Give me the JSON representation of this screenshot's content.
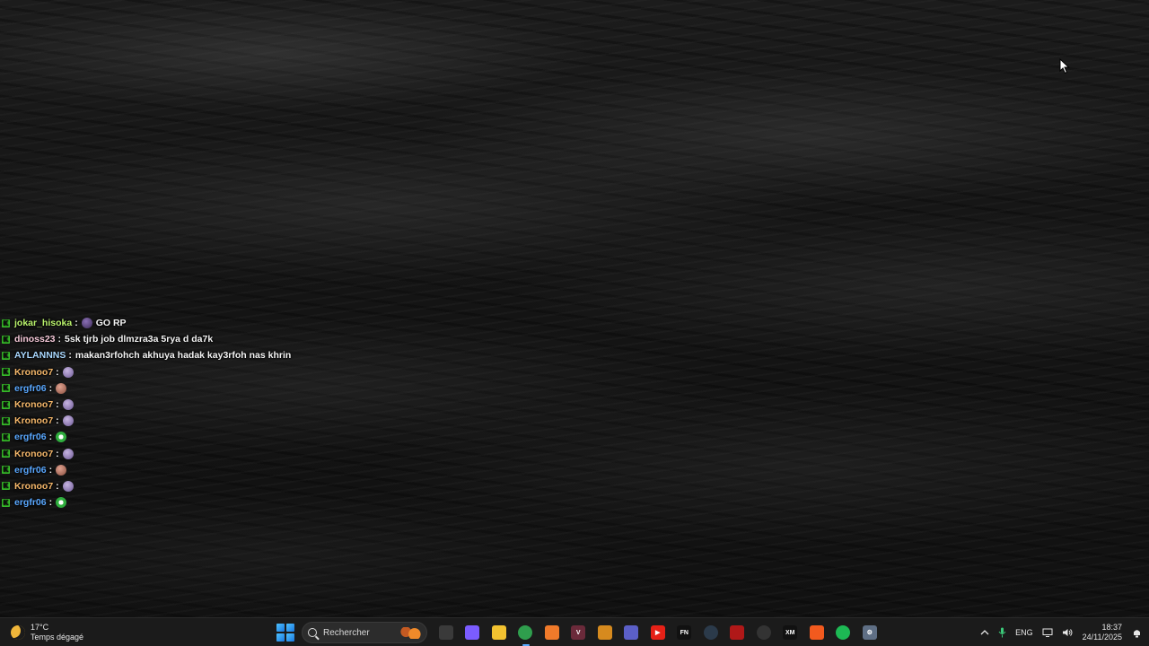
{
  "chat": [
    {
      "user": "jokar_hisoka",
      "color": "#b9f26c",
      "emote": "dark",
      "text": "GO RP"
    },
    {
      "user": "dinoss23",
      "color": "#f4c8d8",
      "emote": "",
      "text": "5sk tjrb job dlmzra3a 5rya d da7k"
    },
    {
      "user": "AYLANNNS",
      "color": "#a9d8ff",
      "emote": "",
      "text": "makan3rfohch akhuya hadak kay3rfoh nas khrin"
    },
    {
      "user": "Kronoo7",
      "color": "#f6b86b",
      "emote": "purple",
      "text": ""
    },
    {
      "user": "ergfr06",
      "color": "#5aa8ff",
      "emote": "face",
      "text": ""
    },
    {
      "user": "Kronoo7",
      "color": "#f6b86b",
      "emote": "purple",
      "text": ""
    },
    {
      "user": "Kronoo7",
      "color": "#f6b86b",
      "emote": "purple",
      "text": ""
    },
    {
      "user": "ergfr06",
      "color": "#5aa8ff",
      "emote": "green",
      "text": ""
    },
    {
      "user": "Kronoo7",
      "color": "#f6b86b",
      "emote": "purple",
      "text": ""
    },
    {
      "user": "ergfr06",
      "color": "#5aa8ff",
      "emote": "face",
      "text": ""
    },
    {
      "user": "Kronoo7",
      "color": "#f6b86b",
      "emote": "purple",
      "text": ""
    },
    {
      "user": "ergfr06",
      "color": "#5aa8ff",
      "emote": "green",
      "text": ""
    }
  ],
  "taskbar": {
    "weather": {
      "temp": "17°C",
      "desc": "Temps dégagé"
    },
    "search_label": "Rechercher",
    "apps": [
      {
        "name": "task-view-icon",
        "color": "#3a3a3a",
        "text": ""
      },
      {
        "name": "copilot-icon",
        "color": "#7b5cff",
        "text": ""
      },
      {
        "name": "file-explorer-icon",
        "color": "#f2c230",
        "text": ""
      },
      {
        "name": "chrome-icon",
        "color": "#2f9e4d",
        "text": "",
        "active": true
      },
      {
        "name": "app-orange-icon",
        "color": "#f07a2a",
        "text": ""
      },
      {
        "name": "app-maroon-icon",
        "color": "#6b2a3a",
        "text": "V"
      },
      {
        "name": "shield-app-icon",
        "color": "#d68a1e",
        "text": ""
      },
      {
        "name": "teams-icon",
        "color": "#5b5fc7",
        "text": ""
      },
      {
        "name": "youtube-icon",
        "color": "#e62117",
        "text": "▶"
      },
      {
        "name": "fn-app-icon",
        "color": "#111111",
        "text": "FN"
      },
      {
        "name": "steam-icon",
        "color": "#2b3a4a",
        "text": ""
      },
      {
        "name": "red-app-icon",
        "color": "#b01818",
        "text": ""
      },
      {
        "name": "obs-icon",
        "color": "#333333",
        "text": ""
      },
      {
        "name": "xm-app-icon",
        "color": "#111111",
        "text": "XM"
      },
      {
        "name": "brave-icon",
        "color": "#f25a1e",
        "text": ""
      },
      {
        "name": "spotify-icon",
        "color": "#1db954",
        "text": ""
      },
      {
        "name": "settings-icon",
        "color": "#5f6f85",
        "text": "⚙"
      }
    ],
    "tray": {
      "lang": "ENG",
      "time": "18:37",
      "date": "24/11/2025"
    }
  }
}
